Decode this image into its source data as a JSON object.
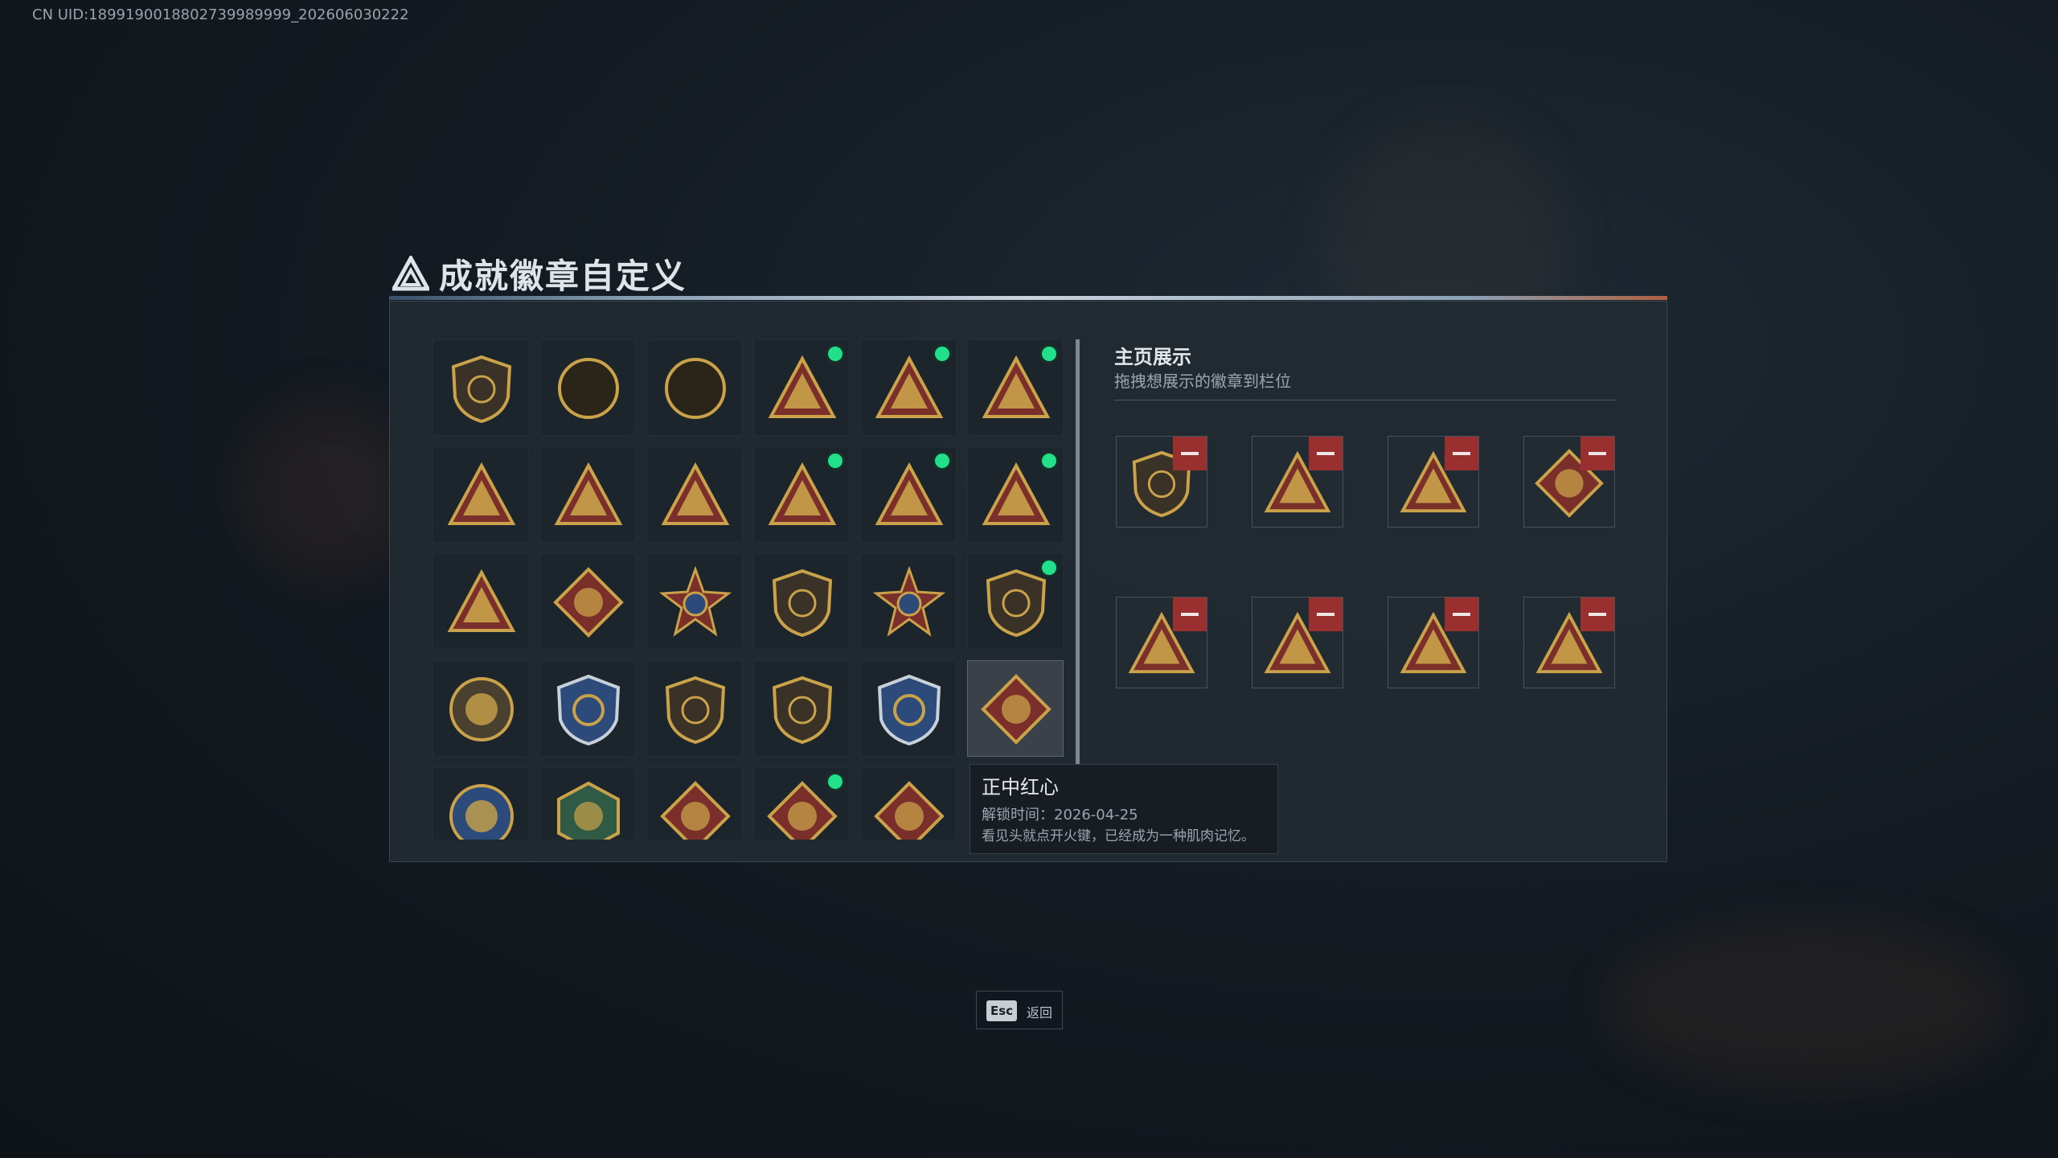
{
  "uid_text": "CN UID:1899190018802739989999_202606030222",
  "header": {
    "title": "成就徽章自定义"
  },
  "colors": {
    "accent_green": "#22e08a",
    "remove_red": "#9a2f2f",
    "gold": "#c9a24a",
    "crimson": "#7a2f2a"
  },
  "badge_grid": [
    {
      "icon": "shield-delta-badge",
      "new": false
    },
    {
      "icon": "helicopter-shield-badge",
      "new": false
    },
    {
      "icon": "sword-wings-shield-badge",
      "new": false
    },
    {
      "icon": "triangle-s6-badge",
      "new": true
    },
    {
      "icon": "triangle-s7-badge",
      "new": true
    },
    {
      "icon": "triangle-s8-badge",
      "new": true
    },
    {
      "icon": "triangle-tank-badge",
      "new": false
    },
    {
      "icon": "triangle-boat-badge",
      "new": false
    },
    {
      "icon": "triangle-number-one-badge",
      "new": false
    },
    {
      "icon": "triangle-bag-badge",
      "new": true
    },
    {
      "icon": "triangle-soldier-badge",
      "new": true
    },
    {
      "icon": "triangle-rocket-badge",
      "new": true
    },
    {
      "icon": "triangle-eagle-badge",
      "new": false
    },
    {
      "icon": "diamond-crystal-badge",
      "new": false
    },
    {
      "icon": "star-medal-badge",
      "new": false
    },
    {
      "icon": "shield-flame-badge",
      "new": false
    },
    {
      "icon": "stars-crest-badge",
      "new": false
    },
    {
      "icon": "shield-gem-badge",
      "new": true
    },
    {
      "icon": "circle-skull-badge",
      "new": false
    },
    {
      "icon": "blue-rifle-crest-badge",
      "new": false
    },
    {
      "icon": "shield-rifle-badge",
      "new": false
    },
    {
      "icon": "shield-crossed-badge",
      "new": false
    },
    {
      "icon": "blue-gold-crest-badge",
      "new": false
    },
    {
      "icon": "diamond-wolf-badge",
      "new": false,
      "selected": true
    },
    {
      "icon": "circle-eagle-badge",
      "new": false
    },
    {
      "icon": "green-dragon-badge",
      "new": false
    },
    {
      "icon": "diamond-dragon-badge",
      "new": false
    },
    {
      "icon": "diamond-dragon-badge-2",
      "new": true
    },
    {
      "icon": "diamond-runner-badge",
      "new": false
    }
  ],
  "tooltip": {
    "name": "正中红心",
    "unlock_date": "解锁时间：2026-04-25",
    "description": "看见头就点开火键，已经成为一种肌肉记忆。"
  },
  "display": {
    "title": "主页展示",
    "subtitle": "拖拽想展示的徽章到栏位",
    "slots": [
      {
        "icon": "shield-gem-badge"
      },
      {
        "icon": "triangle-bag-badge"
      },
      {
        "icon": "triangle-rocket-badge"
      },
      {
        "icon": "diamond-dragon-badge"
      },
      {
        "icon": "triangle-s8-badge"
      },
      {
        "icon": "triangle-s6-badge"
      },
      {
        "icon": "triangle-s7-badge"
      },
      {
        "icon": "triangle-soldier-badge"
      }
    ]
  },
  "footer": {
    "esc_key": "Esc",
    "esc_label": "返回"
  }
}
